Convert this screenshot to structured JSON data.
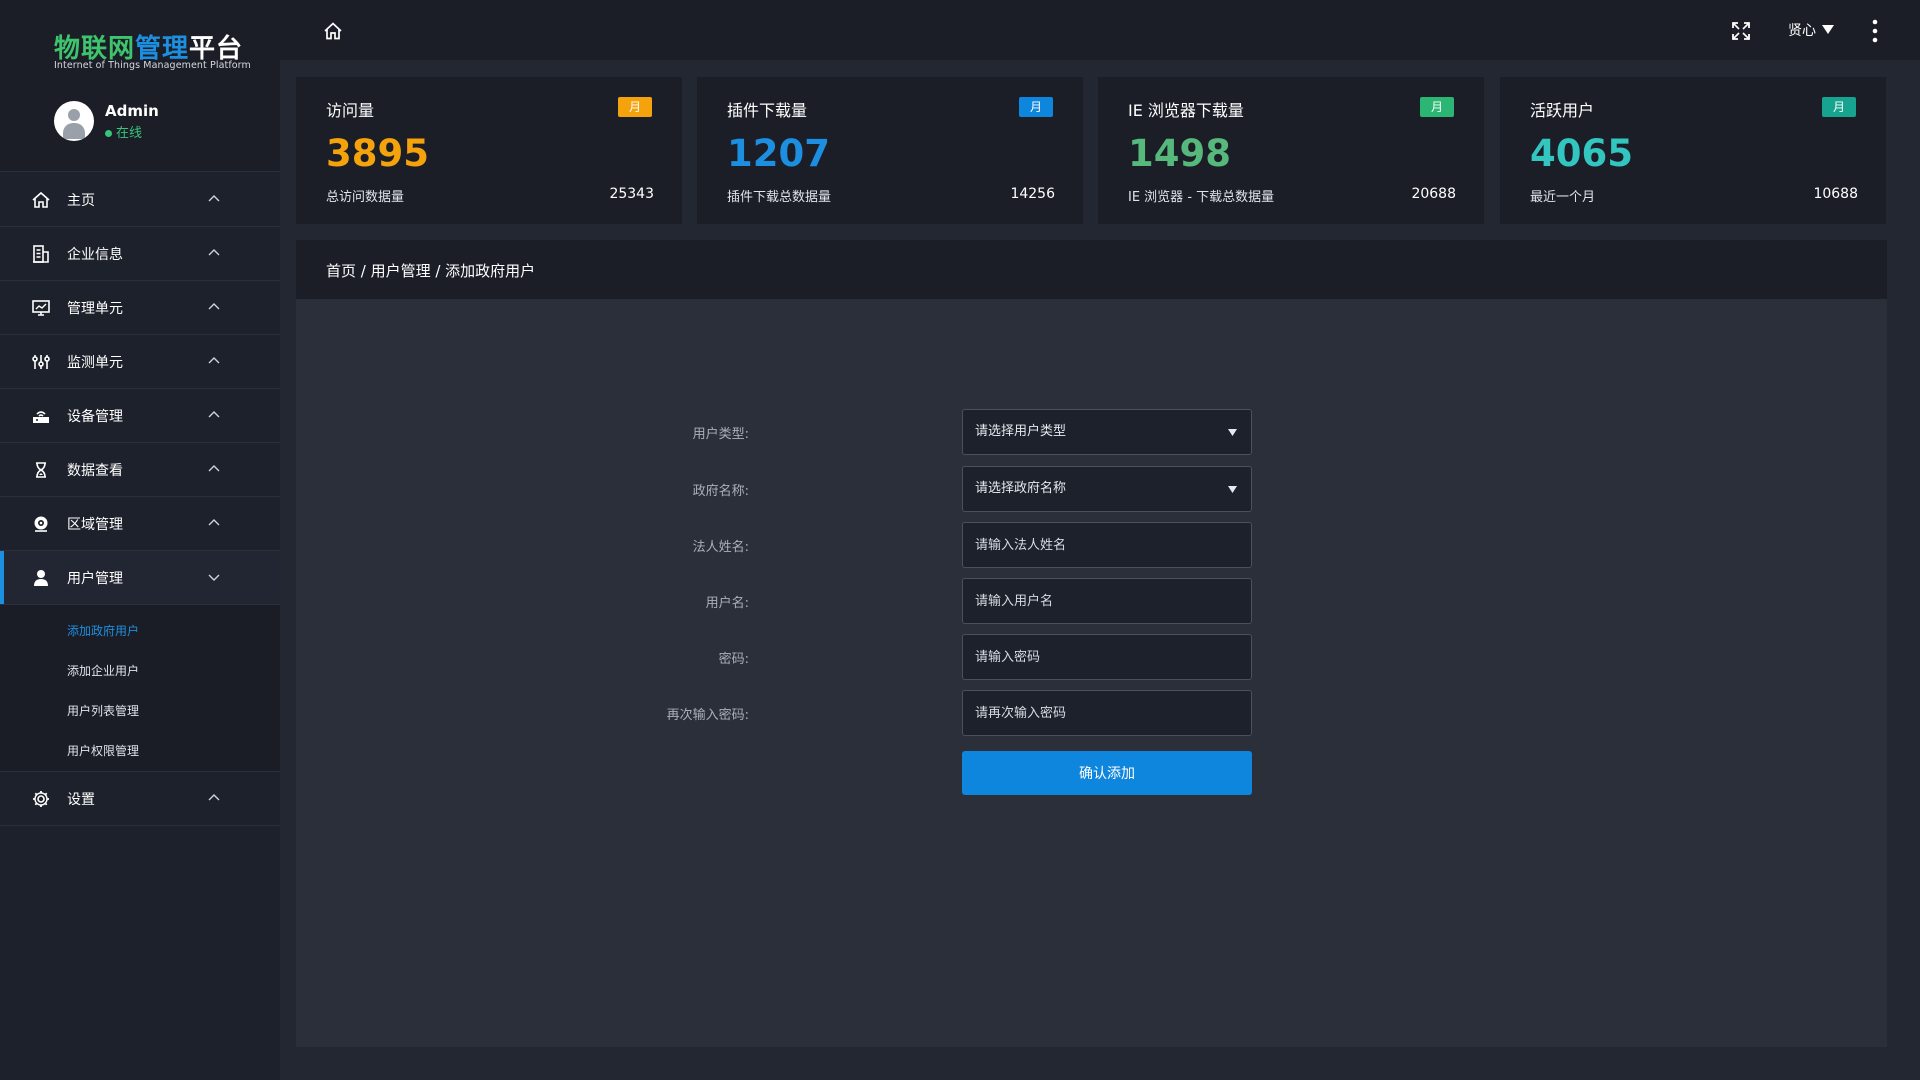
{
  "brand": {
    "logo_part1": "物联网",
    "logo_part2": "管理",
    "logo_part3": "平台",
    "subtitle": "Internet of Things Management Platform"
  },
  "user": {
    "name": "Admin",
    "status": "在线"
  },
  "sidebar": {
    "items": [
      {
        "label": "主页",
        "icon": "home-icon"
      },
      {
        "label": "企业信息",
        "icon": "building-icon"
      },
      {
        "label": "管理单元",
        "icon": "monitor-chart-icon"
      },
      {
        "label": "监测单元",
        "icon": "sliders-icon"
      },
      {
        "label": "设备管理",
        "icon": "router-icon"
      },
      {
        "label": "数据查看",
        "icon": "hourglass-icon"
      },
      {
        "label": "区域管理",
        "icon": "location-icon"
      },
      {
        "label": "用户管理",
        "icon": "user-icon"
      },
      {
        "label": "设置",
        "icon": "gear-icon"
      }
    ],
    "submenu": [
      {
        "label": "添加政府用户"
      },
      {
        "label": "添加企业用户"
      },
      {
        "label": "用户列表管理"
      },
      {
        "label": "用户权限管理"
      }
    ]
  },
  "topbar": {
    "user_label": "贤心"
  },
  "stats": [
    {
      "title": "访问量",
      "badge": "月",
      "badge_color": "#f5a30c",
      "value": "3895",
      "value_color": "#f5a30c",
      "desc": "总访问数据量",
      "total": "25343"
    },
    {
      "title": "插件下载量",
      "badge": "月",
      "badge_color": "#0f86de",
      "value": "1207",
      "value_color": "#1d8fe0",
      "desc": "插件下载总数据量",
      "total": "14256"
    },
    {
      "title": "IE 浏览器下载量",
      "badge": "月",
      "badge_color": "#2bb673",
      "value": "1498",
      "value_color": "#56b87a",
      "desc": "IE 浏览器 - 下载总数据量",
      "total": "20688"
    },
    {
      "title": "活跃用户",
      "badge": "月",
      "badge_color": "#16a38f",
      "value": "4065",
      "value_color": "#33c6c0",
      "desc": "最近一个月",
      "total": "10688"
    }
  ],
  "breadcrumb": "首页 / 用户管理 / 添加政府用户",
  "form": {
    "user_type": {
      "label": "用户类型:",
      "placeholder": "请选择用户类型"
    },
    "gov_name": {
      "label": "政府名称:",
      "placeholder": "请选择政府名称"
    },
    "legal_name": {
      "label": "法人姓名:",
      "placeholder": "请输入法人姓名"
    },
    "username": {
      "label": "用户名:",
      "placeholder": "请输入用户名"
    },
    "password": {
      "label": "密码:",
      "placeholder": "请输入密码"
    },
    "password_confirm": {
      "label": "再次输入密码:",
      "placeholder": "请再次输入密码"
    },
    "submit_label": "确认添加"
  },
  "colors": {
    "accent": "#1d8fe0",
    "online": "#37c57a"
  }
}
